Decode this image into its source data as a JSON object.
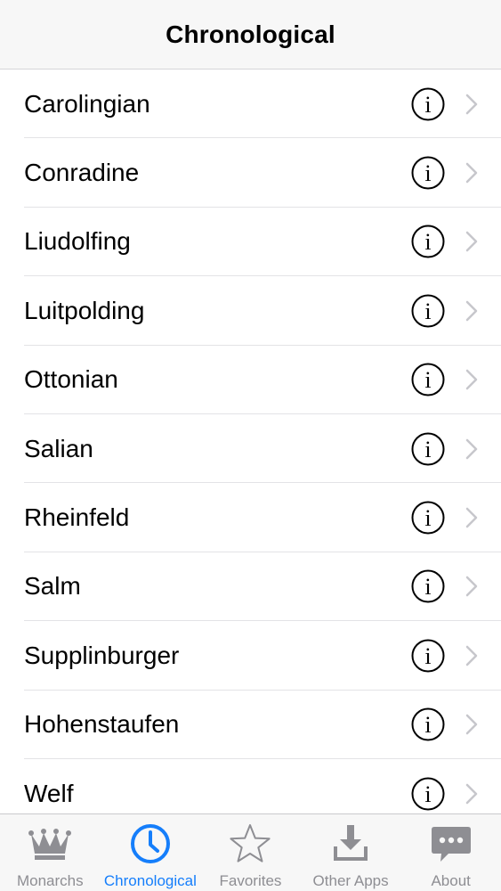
{
  "header": {
    "title": "Chronological"
  },
  "list": {
    "items": [
      {
        "label": "Carolingian"
      },
      {
        "label": "Conradine"
      },
      {
        "label": "Liudolfing"
      },
      {
        "label": "Luitpolding"
      },
      {
        "label": "Ottonian"
      },
      {
        "label": "Salian"
      },
      {
        "label": "Rheinfeld"
      },
      {
        "label": "Salm"
      },
      {
        "label": "Supplinburger"
      },
      {
        "label": "Hohenstaufen"
      },
      {
        "label": "Welf"
      }
    ],
    "row_icons": [
      "info-icon",
      "chevron-right-icon"
    ]
  },
  "tabbar": {
    "tabs": [
      {
        "label": "Monarchs",
        "icon": "crown-icon",
        "active": false
      },
      {
        "label": "Chronological",
        "icon": "clock-icon",
        "active": true
      },
      {
        "label": "Favorites",
        "icon": "star-icon",
        "active": false
      },
      {
        "label": "Other Apps",
        "icon": "download-icon",
        "active": false
      },
      {
        "label": "About",
        "icon": "chat-bubble-icon",
        "active": false
      }
    ]
  },
  "colors": {
    "accent": "#157efb",
    "inactive": "#8e8e93",
    "chevron": "#c7c7cc"
  }
}
